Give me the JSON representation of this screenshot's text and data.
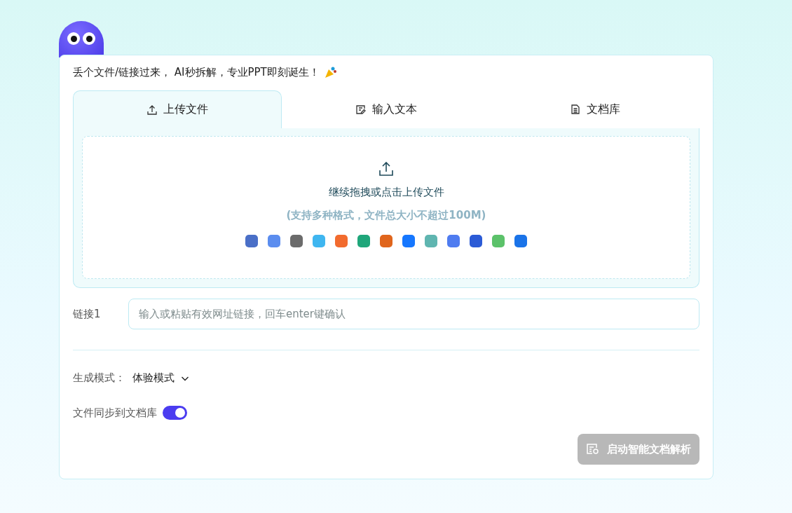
{
  "headline": "丢个文件/链接过来， AI秒拆解，专业PPT即刻诞生！",
  "tabs": [
    {
      "label": "上传文件",
      "kind": "upload",
      "selected": true
    },
    {
      "label": "输入文本",
      "kind": "text",
      "selected": false
    },
    {
      "label": "文档库",
      "kind": "library",
      "selected": false
    }
  ],
  "dropzone": {
    "title": "继续拖拽或点击上传文件",
    "hint": "(支持多种格式，文件总大小不超过100M)",
    "formats": [
      {
        "color": "#4a6fc7"
      },
      {
        "color": "#5b8def"
      },
      {
        "color": "#6b6b6b"
      },
      {
        "color": "#3fb6f0"
      },
      {
        "color": "#f26b2e"
      },
      {
        "color": "#1fa67a"
      },
      {
        "color": "#e0651c"
      },
      {
        "color": "#1677ff"
      },
      {
        "color": "#5fb5b0"
      },
      {
        "color": "#4f7cf0"
      },
      {
        "color": "#2b5bd6"
      },
      {
        "color": "#5cc26a"
      },
      {
        "color": "#1a73e8"
      }
    ]
  },
  "link": {
    "label": "链接1",
    "placeholder": "输入或粘贴有效网址链接，回车enter键确认"
  },
  "mode": {
    "label": "生成模式：",
    "value": "体验模式"
  },
  "sync": {
    "label": "文件同步到文档库",
    "on": true
  },
  "submit": {
    "label": "启动智能文档解析",
    "disabled": true
  }
}
